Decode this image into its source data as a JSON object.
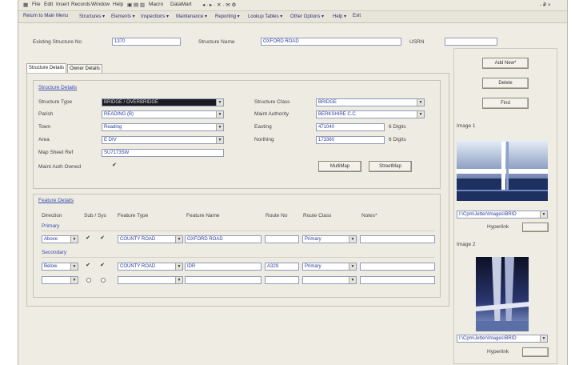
{
  "menubar": {
    "items": [
      "File",
      "Edit",
      "Insert",
      "Records",
      "Window",
      "Help",
      "Macro",
      "DataMart"
    ],
    "window_controls": "- ₽ ×"
  },
  "toolbar": {
    "items": [
      "Return to Main Menu",
      "Structures ▾",
      "Elements ▾",
      "Inspections ▾",
      "Maintenance ▾",
      "Reporting ▾",
      "Lookup Tables ▾",
      "Other Options ▾",
      "Help ▾",
      "Exit"
    ]
  },
  "header": {
    "existing_label": "Existing Structure No",
    "existing_value": "1370",
    "name_label": "Structure Name",
    "name_value": "OXFORD ROAD",
    "usrn_label": "USRN",
    "usrn_value": ""
  },
  "tabs": [
    "Structure Details",
    "Owner Details"
  ],
  "structure": {
    "section_title": "Structure Details",
    "fields": {
      "type": {
        "label": "Structure Type",
        "value": "BRIDGE / OVERBRIDGE"
      },
      "parish": {
        "label": "Parish",
        "value": "READING (B)"
      },
      "town": {
        "label": "Town",
        "value": "Reading"
      },
      "area": {
        "label": "Area",
        "value": "E DIV"
      },
      "mapsheet": {
        "label": "Map Sheet Ref",
        "value": "SU7173SW"
      },
      "maint_owned": {
        "label": "Maint Auth Owned",
        "value": "✔"
      },
      "class": {
        "label": "Structure Class",
        "value": "BRIDGE"
      },
      "authority": {
        "label": "Maint Authority",
        "value": "BERKSHIRE C.C."
      },
      "easting": {
        "label": "Easting",
        "value": "471040",
        "hint": "6 Digits"
      },
      "northing": {
        "label": "Northing",
        "value": "173360",
        "hint": "6 Digits"
      }
    },
    "buttons": {
      "multimap": "MultiMap",
      "streetmap": "StreetMap"
    }
  },
  "feature": {
    "section_title": "Feature Details",
    "headers": [
      "Direction",
      "Sub / Sys",
      "Feature Type",
      "Feature Name",
      "Route No",
      "Route Class",
      "Notes*"
    ],
    "primary_label": "Primary",
    "secondary_label": "Secondary",
    "rows": [
      {
        "direction": "Above",
        "sub": "✔",
        "sys": "✔",
        "type": "COUNTY ROAD",
        "name": "OXFORD ROAD",
        "route_no": "",
        "route_class": "Primary",
        "notes": ""
      },
      {
        "direction": "Below",
        "sub": "✔",
        "sys": "✔",
        "type": "COUNTY ROAD",
        "name": "IDR",
        "route_no": "A329",
        "route_class": "Primary",
        "notes": ""
      },
      {
        "direction": "",
        "sub": "",
        "sys": "",
        "type": "",
        "name": "",
        "route_no": "",
        "route_class": "",
        "notes": ""
      }
    ]
  },
  "side": {
    "buttons": {
      "add": "Add New*",
      "delete": "Delete",
      "find": "Find"
    },
    "image1_label": "Image 1",
    "image1_path": "I:\\Cpm\\Jetter\\Images\\BRID",
    "image2_label": "Image 2",
    "image2_path": "I:\\Cpm\\Jetter\\Images\\BRID",
    "hyperlink": "Hyperlink"
  },
  "colors": {
    "accent": "#2b3c9a",
    "window": "#efece3",
    "link": "#3a4fb0"
  }
}
